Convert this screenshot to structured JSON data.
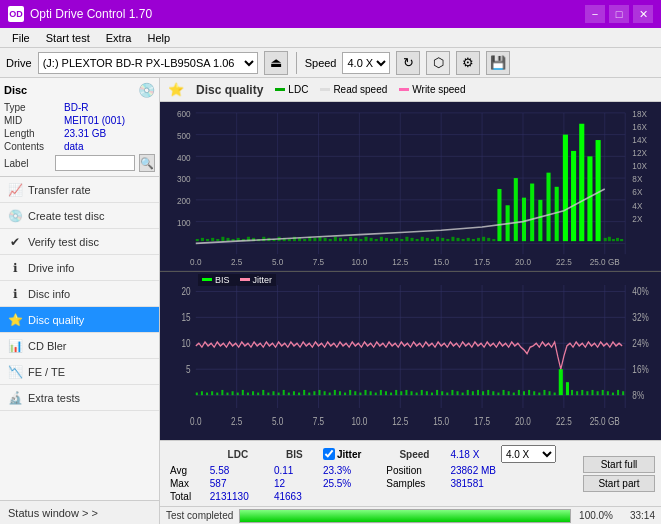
{
  "titlebar": {
    "title": "Opti Drive Control 1.70",
    "icon": "OD",
    "minimize_label": "−",
    "maximize_label": "□",
    "close_label": "✕"
  },
  "menubar": {
    "items": [
      "File",
      "Start test",
      "Extra",
      "Help"
    ]
  },
  "toolbar": {
    "drive_label": "Drive",
    "drive_value": "(J:)  PLEXTOR BD-R  PX-LB950SA 1.06",
    "speed_label": "Speed",
    "speed_value": "4.0 X"
  },
  "disc_panel": {
    "title": "Disc",
    "fields": [
      {
        "label": "Type",
        "value": "BD-R"
      },
      {
        "label": "MID",
        "value": "MEIT01 (001)"
      },
      {
        "label": "Length",
        "value": "23.31 GB"
      },
      {
        "label": "Contents",
        "value": "data"
      },
      {
        "label": "Label",
        "value": ""
      }
    ]
  },
  "nav": {
    "items": [
      {
        "label": "Transfer rate",
        "icon": "📈",
        "active": false
      },
      {
        "label": "Create test disc",
        "icon": "💿",
        "active": false
      },
      {
        "label": "Verify test disc",
        "icon": "✔",
        "active": false
      },
      {
        "label": "Drive info",
        "icon": "ℹ",
        "active": false
      },
      {
        "label": "Disc info",
        "icon": "ℹ",
        "active": false
      },
      {
        "label": "Disc quality",
        "icon": "⭐",
        "active": true
      },
      {
        "label": "CD Bler",
        "icon": "📊",
        "active": false
      },
      {
        "label": "FE / TE",
        "icon": "📉",
        "active": false
      },
      {
        "label": "Extra tests",
        "icon": "🔬",
        "active": false
      }
    ],
    "status_window": "Status window > >"
  },
  "chart": {
    "title": "Disc quality",
    "icon": "⭐",
    "legend": [
      {
        "label": "LDC",
        "color": "#00aa00"
      },
      {
        "label": "Read speed",
        "color": "#ffffff"
      },
      {
        "label": "Write speed",
        "color": "#ff69b4"
      }
    ],
    "legend2": [
      {
        "label": "BIS",
        "color": "#00ee00"
      },
      {
        "label": "Jitter",
        "color": "#ff69b4"
      }
    ],
    "upper_y_left": [
      "600",
      "500",
      "400",
      "300",
      "200",
      "100",
      "0"
    ],
    "upper_y_right": [
      "18X",
      "16X",
      "14X",
      "12X",
      "10X",
      "8X",
      "6X",
      "4X",
      "2X"
    ],
    "upper_x": [
      "0.0",
      "2.5",
      "5.0",
      "7.5",
      "10.0",
      "12.5",
      "15.0",
      "17.5",
      "20.0",
      "22.5",
      "25.0 GB"
    ],
    "lower_y_left": [
      "20",
      "15",
      "10",
      "5"
    ],
    "lower_y_right": [
      "40%",
      "32%",
      "24%",
      "16%",
      "8%"
    ],
    "lower_x": [
      "0.0",
      "2.5",
      "5.0",
      "7.5",
      "10.0",
      "12.5",
      "15.0",
      "17.5",
      "20.0",
      "22.5",
      "25.0 GB"
    ]
  },
  "stats": {
    "columns": [
      "",
      "LDC",
      "BIS",
      "",
      "Jitter",
      "Speed",
      ""
    ],
    "rows": [
      {
        "label": "Avg",
        "ldc": "5.58",
        "bis": "0.11",
        "jitter": "23.3%",
        "speed_label": "Position",
        "speed_val": "23862 MB"
      },
      {
        "label": "Max",
        "ldc": "587",
        "bis": "12",
        "jitter": "25.5%",
        "speed_label": "Samples",
        "speed_val": "381581"
      },
      {
        "label": "Total",
        "ldc": "2131130",
        "bis": "41663"
      }
    ],
    "speed_current": "4.18 X",
    "speed_select": "4.0 X",
    "jitter_checked": true,
    "jitter_label": "Jitter"
  },
  "buttons": {
    "start_full": "Start full",
    "start_part": "Start part"
  },
  "progress": {
    "percent": "100.0%",
    "time": "33:14"
  }
}
